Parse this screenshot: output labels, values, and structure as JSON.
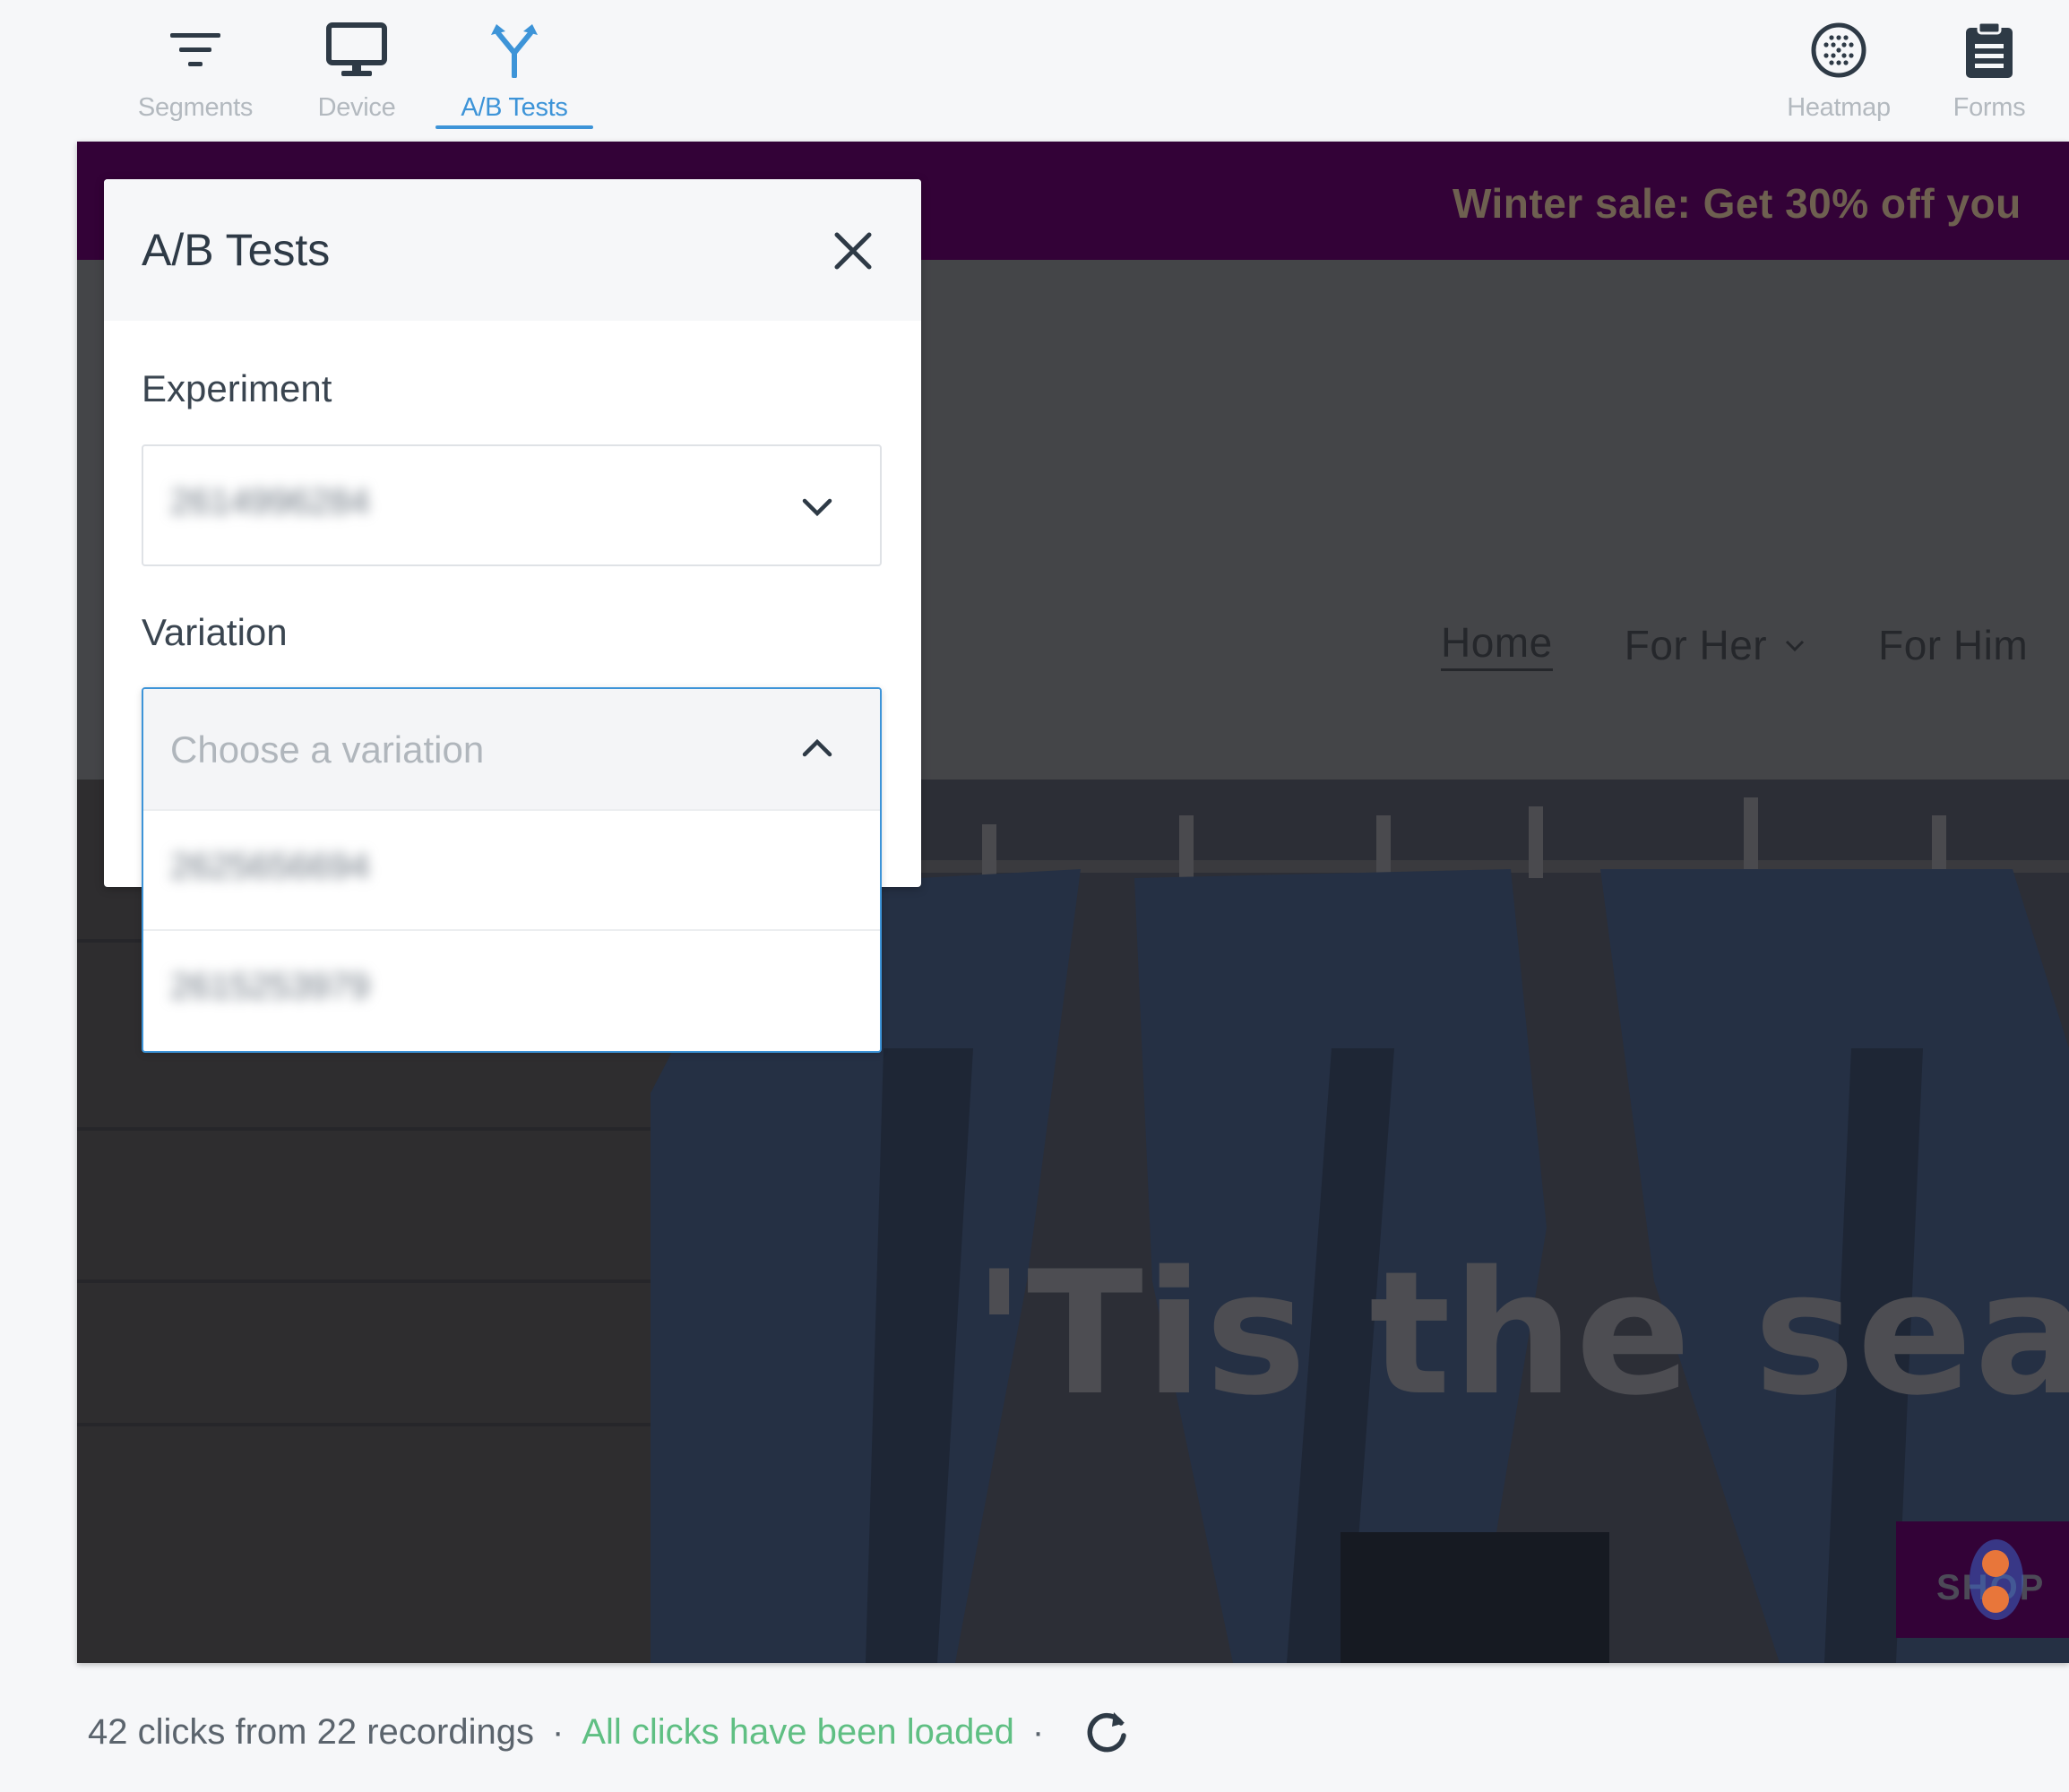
{
  "toolbar": {
    "segments_label": "Segments",
    "device_label": "Device",
    "ab_tests_label": "A/B Tests",
    "heatmap_label": "Heatmap",
    "forms_label": "Forms",
    "active_tool": "A/B Tests",
    "icons": {
      "segments": "filter-icon",
      "device": "monitor-icon",
      "ab_tests": "split-arrows-icon",
      "heatmap": "heatmap-circle-icon",
      "forms": "clipboard-icon"
    }
  },
  "preview": {
    "promo_text": "Winter sale: Get 30% off you",
    "nav": {
      "home": "Home",
      "for_her": "For Her",
      "for_him": "For Him"
    },
    "hero_title": "'Tis the seas",
    "shop_button": "SHOP"
  },
  "ab_panel": {
    "title": "A/B Tests",
    "experiment_label": "Experiment",
    "experiment_value": "2614996284",
    "variation_label": "Variation",
    "variation_placeholder": "Choose a variation",
    "variation_options": [
      "2625656694",
      "2615253979"
    ]
  },
  "status": {
    "clicks_text": "42 clicks from 22 recordings",
    "separator": "·",
    "loaded_text": "All clicks have been loaded"
  },
  "colors": {
    "accent": "#3d94d8",
    "success": "#5fbf83",
    "promo_bar": "#330237"
  }
}
